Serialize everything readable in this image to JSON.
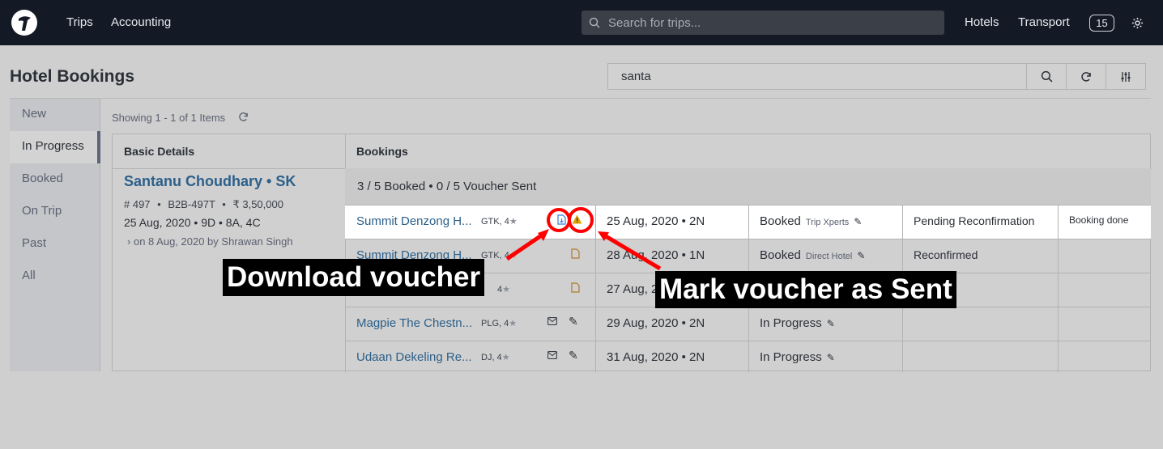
{
  "nav": {
    "links": [
      "Trips",
      "Accounting"
    ],
    "search_placeholder": "Search for trips...",
    "right_links": [
      "Hotels",
      "Transport"
    ],
    "notification_count": "15"
  },
  "page": {
    "title": "Hotel Bookings",
    "filter_value": "santa",
    "showing": "Showing 1 - 1 of 1 Items"
  },
  "sidebar": {
    "items": [
      "New",
      "In Progress",
      "Booked",
      "On Trip",
      "Past",
      "All"
    ],
    "active": "In Progress"
  },
  "table": {
    "headers": [
      "Basic Details",
      "Bookings"
    ],
    "guest": {
      "name": "Santanu Choudhary • SK",
      "trip_no": "# 497",
      "ref": "B2B-497T",
      "amount": "₹ 3,50,000",
      "dates": "25 Aug, 2020  •  9D  •  8A, 4C",
      "created": "on 8 Aug, 2020 by Shrawan Singh"
    },
    "summary": "3 / 5 Booked  •  0 / 5 Voucher Sent",
    "rows": [
      {
        "hotel": "Summit Denzong H...",
        "code": "GTK, 4",
        "date": "25 Aug, 2020  •  2N",
        "status": "Booked",
        "source": "Trip Xperts",
        "reconfirmation": "Pending Reconfirmation",
        "note": "Booking done"
      },
      {
        "hotel": "Summit Denzong H...",
        "code": "GTK, 4",
        "date": "28 Aug, 2020  •  1N",
        "status": "Booked",
        "source": "Direct Hotel",
        "reconfirmation": "Reconfirmed",
        "note": ""
      },
      {
        "hotel": "",
        "code": "4",
        "date": "27 Aug, 2020",
        "status": "",
        "source": "",
        "reconfirmation": "",
        "note": ""
      },
      {
        "hotel": "Magpie The Chestn...",
        "code": "PLG, 4",
        "date": "29 Aug, 2020  •  2N",
        "status": "In Progress",
        "source": "",
        "reconfirmation": "",
        "note": ""
      },
      {
        "hotel": "Udaan Dekeling Re...",
        "code": "DJ, 4",
        "date": "31 Aug, 2020  •  2N",
        "status": "In Progress",
        "source": "",
        "reconfirmation": "",
        "note": ""
      }
    ]
  },
  "annotations": {
    "download": "Download voucher",
    "mark_sent": "Mark voucher as Sent",
    "color": "#ff0000"
  }
}
